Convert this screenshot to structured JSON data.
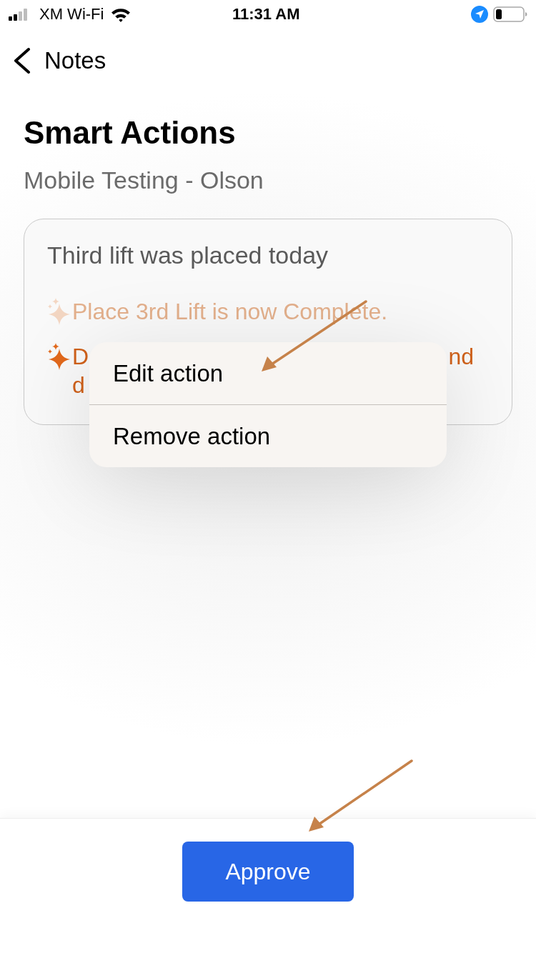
{
  "status_bar": {
    "carrier": "XM Wi-Fi",
    "time": "11:31 AM"
  },
  "nav": {
    "back_label": "Notes"
  },
  "title": "Smart Actions",
  "subtitle": "Mobile Testing - Olson",
  "note": {
    "text": "Third lift was placed today",
    "actions": [
      {
        "dimmed": true,
        "lines": [
          [
            "Place 3rd Lift is now Complete."
          ]
        ]
      },
      {
        "dimmed": false,
        "lines": [
          [
            "D",
            "nd"
          ],
          [
            "d"
          ]
        ]
      }
    ]
  },
  "context_menu": {
    "items": [
      "Edit action",
      "Remove action"
    ]
  },
  "approve_button": {
    "label": "Approve"
  }
}
